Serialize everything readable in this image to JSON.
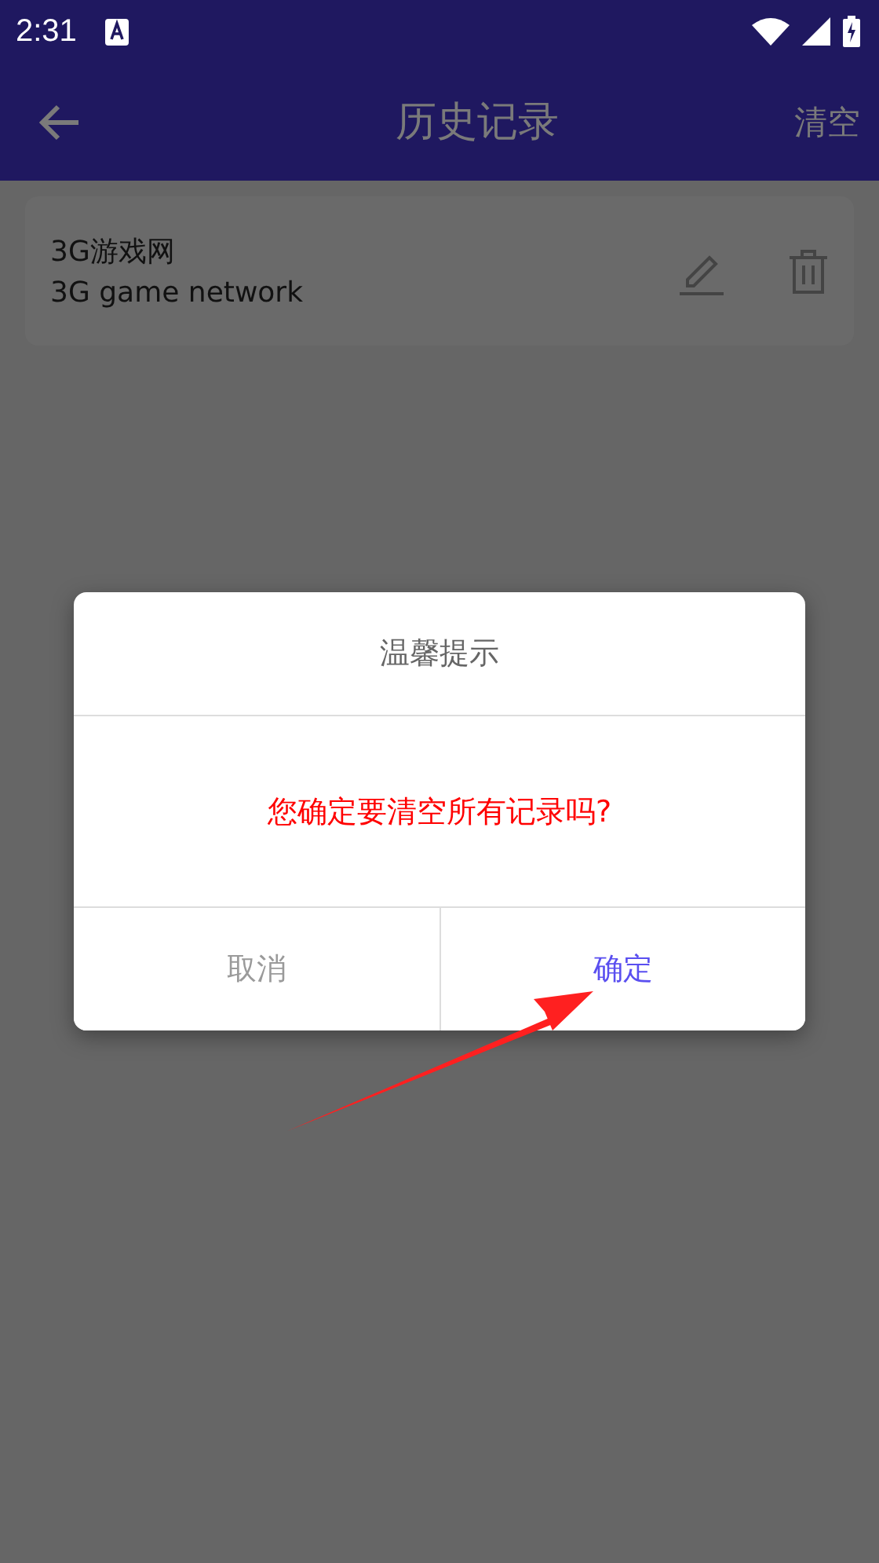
{
  "status_bar": {
    "time": "2:31"
  },
  "app_bar": {
    "title": "历史记录",
    "action": "清空"
  },
  "history": [
    {
      "title": "3G游戏网",
      "subtitle": "3G game network"
    }
  ],
  "dialog": {
    "title": "温馨提示",
    "message": "您确定要清空所有记录吗?",
    "buttons": [
      {
        "label": "取消",
        "kind": "cancel"
      },
      {
        "label": "确定",
        "kind": "confirm"
      }
    ]
  }
}
